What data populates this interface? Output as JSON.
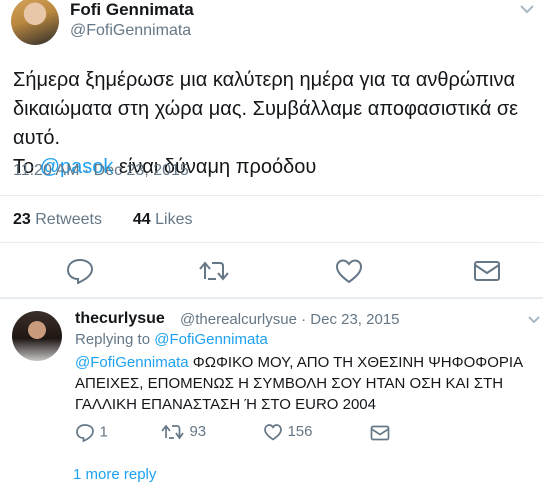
{
  "tweet": {
    "author_name": "Fofi Gennimata",
    "author_handle": "@FofiGennimata",
    "text_line1": "Σήμερα ξημέρωσε μια καλύτερη ημέρα για τα ανθρώπινα",
    "text_line2": "δικαιώματα στη χώρα μας. Συμβάλλαμε αποφασιστικά σε αυτό.",
    "text_line3_prefix": "Το ",
    "text_mention": "@pasok",
    "text_line3_suffix": " είναι δύναμη προόδου",
    "timestamp": "11:20 AM · Dec 23, 2015",
    "retweets_count": "23",
    "retweets_label": "Retweets",
    "likes_count": "44",
    "likes_label": "Likes",
    "icons": [
      "reply-icon",
      "retweet-icon",
      "like-icon",
      "message-icon",
      "chevron-down-icon"
    ]
  },
  "reply": {
    "author_name": "thecurlysue",
    "meta": "@therealcurlysue · Dec 23, 2015",
    "replying_to_label": "Replying to ",
    "replying_to_handle": "@FofiGennimata",
    "mention": "@FofiGennimata",
    "text_1": " ΦΩΦΙΚΟ ΜΟΥ, ΑΠΟ ΤΗ ΧΘΕΣΙΝΗ ΨΗΦΟΦΟΡΙΑ",
    "text_2": "ΑΠΕΙΧΕΣ, ΕΠΟΜΕΝΩΣ Η ΣΥΜΒΟΛΗ ΣΟΥ ΗΤΑΝ ΟΣΗ ΚΑΙ ΣΤΗ",
    "text_3": "ΓΑΛΛΙΚΗ ΕΠΑΝΑΣΤΑΣΗ Ή ΣΤΟ EURO 2004",
    "reply_count": "1",
    "retweet_count": "93",
    "like_count": "156"
  },
  "more_replies": "1 more reply",
  "colors": {
    "link": "#1da1f2",
    "muted": "#657786",
    "divider": "#e6ecf0"
  }
}
